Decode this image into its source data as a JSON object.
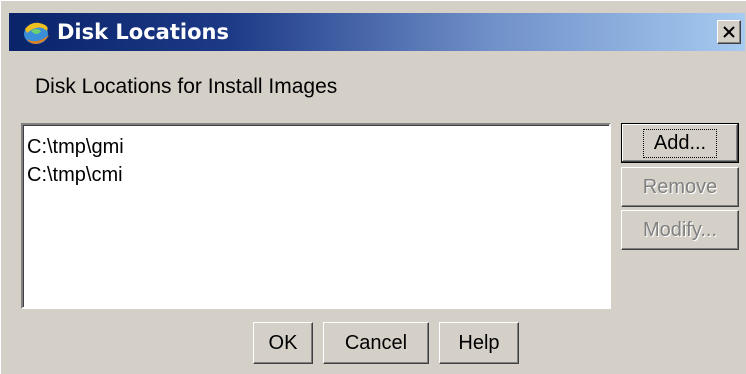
{
  "window": {
    "title": "Disk Locations",
    "close_glyph": "✕"
  },
  "heading": "Disk Locations for Install Images",
  "locations": [
    "C:\\tmp\\gmi",
    "C:\\tmp\\cmi"
  ],
  "side_buttons": {
    "add": "Add...",
    "remove": "Remove",
    "modify": "Modify..."
  },
  "bottom_buttons": {
    "ok": "OK",
    "cancel": "Cancel",
    "help": "Help"
  },
  "icons": {
    "app": "globe-swirl-icon",
    "close": "close-icon"
  },
  "colors": {
    "titlebar_start": "#0a246a",
    "titlebar_end": "#a6caf0",
    "face": "#d4d0c8",
    "disabled_text": "#808080"
  }
}
